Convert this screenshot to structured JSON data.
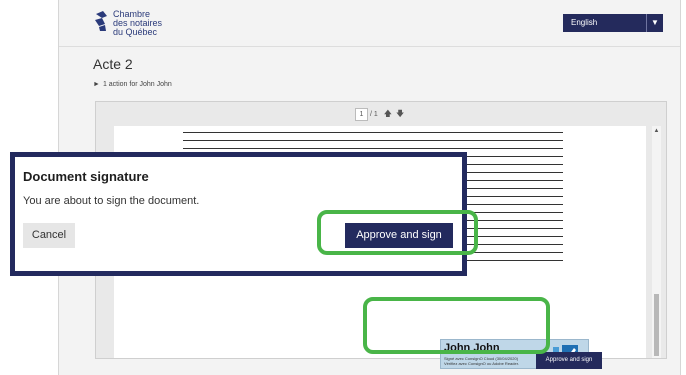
{
  "header": {
    "org_name_lines": [
      "Chambre",
      "des notaires",
      "du Québec"
    ],
    "language": "English"
  },
  "page": {
    "title": "Acte 2",
    "action_line": "1 action for John John"
  },
  "viewer": {
    "page_current": "1",
    "page_total": "/ 1"
  },
  "signature": {
    "name": "John John",
    "sub_line_1": "Signé avec ConsignO Cloud (30/04/2020)",
    "sub_line_2": "Vérifiez avec ConsignO ou Adobe Reader."
  },
  "dialog": {
    "title": "Document signature",
    "message": "You are about to sign the document.",
    "cancel_label": "Cancel",
    "approve_label": "Approve and sign"
  },
  "footer": {
    "approve_small_label": "Approve and sign"
  },
  "colors": {
    "brand": "#232a5e",
    "highlight": "#49b548",
    "signature_bg": "#bfd7e8"
  }
}
